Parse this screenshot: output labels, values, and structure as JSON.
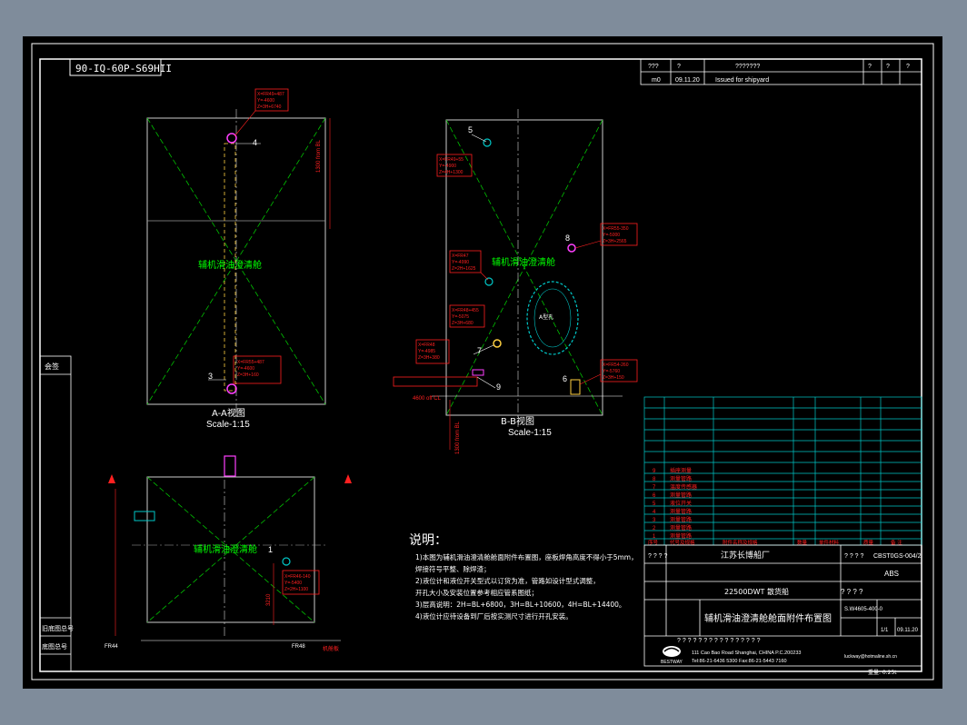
{
  "drawing_no_rotated": "90-IQ-60P-S69HII",
  "revision_table": {
    "header": [
      "???",
      "?",
      "???????",
      "?",
      "?",
      "?"
    ],
    "row": [
      "m0",
      "09.11.20",
      "Issued for shipyard"
    ]
  },
  "views": {
    "aa_title": "A-A视图",
    "aa_scale": "Scale-1:15",
    "bb_title": "B-B视图",
    "bb_scale": "Scale-1:15"
  },
  "tank_labels": {
    "aa": "辅机滑油澄清舱",
    "bb": "辅机滑油澄清舱",
    "plan": "辅机滑油澄清舱",
    "manhole": "A型孔"
  },
  "callouts": {
    "n4": "4",
    "n3": "3",
    "n5": "5",
    "n8": "8",
    "n7": "7",
    "n6": "6",
    "n9": "9",
    "n1": "1",
    "c4": [
      "X=FR49+487",
      "Y=-4600",
      "Z=3H+6740"
    ],
    "c3": [
      "X=FR55+487",
      "Y=-4600",
      "Z=3H+160"
    ],
    "c5": [
      "X=FR49+55",
      "Y=-4900",
      "Z=4H+1300"
    ],
    "c8": [
      "X=FR55-350",
      "Y=-5000",
      "Z=3H+2565"
    ],
    "c_mid": [
      "X=FR47",
      "Y=-4990",
      "Z=2H+1625"
    ],
    "c7a": [
      "X=FR48+455",
      "Y=-5075",
      "Z=3H+680"
    ],
    "c7b": [
      "X=FR48",
      "Y=-4985",
      "Z=3H+380"
    ],
    "c6": [
      "X=FR54-260",
      "Y=-5760",
      "Z=3H+150"
    ],
    "c1": [
      "X=FR46-140",
      "Y=-5400",
      "Z=2H+1100"
    ]
  },
  "dims": {
    "aa_top": "1300 from BL",
    "bb_bottom": "1300 from BL",
    "cl_label": "4600 off CL",
    "fr44": "FR44",
    "fr48": "FR48",
    "plan_dim": "3210",
    "deck": "机舱板"
  },
  "side_labels": [
    "会签",
    "旧底图总号",
    "底图总号"
  ],
  "notes": {
    "title": "说明：",
    "lines": [
      "1)本图为辅机滑油澄清舱舱面附件布置图，座板焊角高度不得小于5mm，",
      "   焊接符号平整、除焊渣；",
      "2)液位计和液位开关型式以订货为准，管路如设计型式调整，",
      "   开孔大小及安装位置参考相应管系图纸；",
      "3)层高说明：2H=BL+6800，3H=BL+10600，4H=BL+14400。",
      "4)液位计应待设备到厂后按实测尺寸进行开孔安装。"
    ]
  },
  "parts_rows": [
    {
      "no": "9",
      "name": "插座测量"
    },
    {
      "no": "8",
      "name": "测量管路"
    },
    {
      "no": "7",
      "name": "温度传感器"
    },
    {
      "no": "6",
      "name": "测量管路"
    },
    {
      "no": "5",
      "name": "液位开关"
    },
    {
      "no": "4",
      "name": "测量管路"
    },
    {
      "no": "3",
      "name": "测量管路"
    },
    {
      "no": "2",
      "name": "测量管路"
    },
    {
      "no": "1",
      "name": "测量管路"
    }
  ],
  "parts_header": [
    "序号",
    "代号及规格",
    "附件名称及规格",
    "数量",
    "单件材料",
    "质量",
    "备 注"
  ],
  "title_block": {
    "company": "江苏长博船厂",
    "drawing_code": "CBST0GS-004/2",
    "class": "ABS",
    "ship": "22500DWT 散货船",
    "title": "辅机滑油澄清舱舱面附件布置图",
    "code2": "S.W4605-400-0",
    "sheet": "1/1",
    "date": "09.11.20",
    "addr1": "111 Cao Bao Road Shanghai, CHINA   P.C.200233",
    "addr2": "Tel:86-21-6436 5300  Fax:86-21-5443 7160",
    "email": "luckway@hotmaline.sh.cn",
    "logo": "BESTWAY",
    "qmarks": "? ? ? ? ? ? ? ? ? ? ? ? ? ? ? ?",
    "q4": "? ? ? ?",
    "weight": "重量: 0.25t"
  },
  "colors": {
    "frame": "#ffffff",
    "diagonal": "#00c000",
    "callout": "#ff2020",
    "table": "#00c8c8",
    "pipe": "#ff40ff",
    "label_green": "#00ff00"
  }
}
